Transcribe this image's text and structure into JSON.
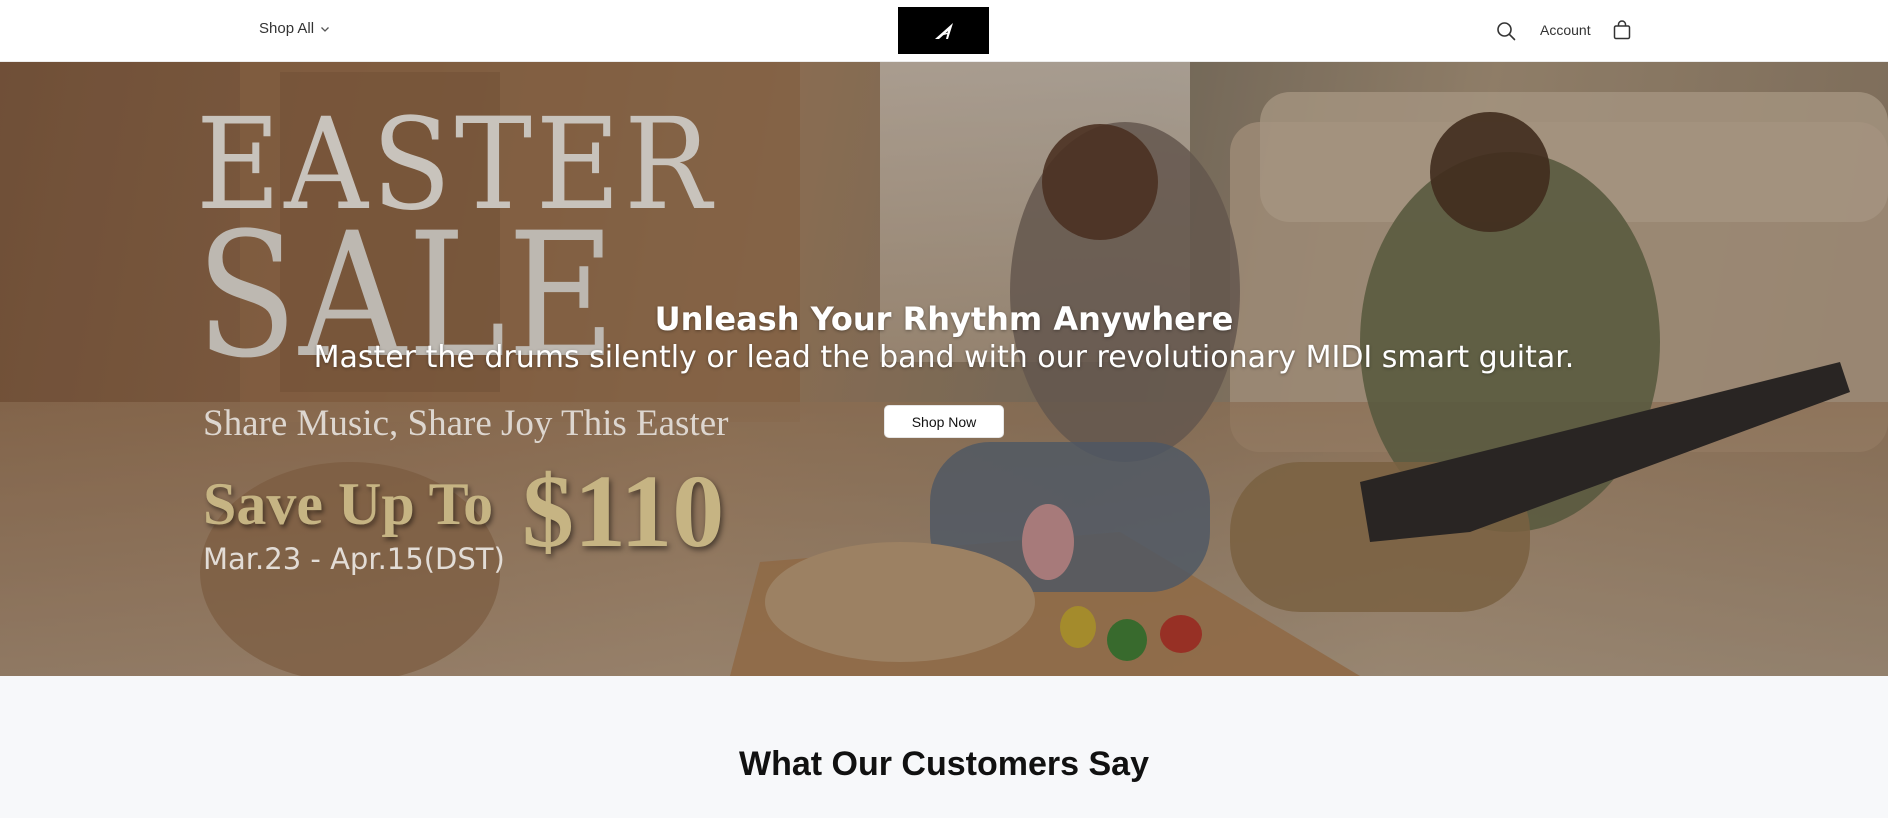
{
  "header": {
    "shop_all_label": "Shop All",
    "account_label": "Account"
  },
  "hero": {
    "banner": {
      "easter": "EASTER",
      "sale": "SALE",
      "tagline": "Share Music, Share Joy This Easter",
      "save_label": "Save Up To",
      "save_amount": "$110",
      "dates": "Mar.23 - Apr.15(DST)"
    },
    "heading": "Unleash Your Rhythm Anywhere",
    "subheading": "Master the drums silently or lead the band with our revolutionary MIDI smart guitar.",
    "cta_label": "Shop Now"
  },
  "testimonials": {
    "title": "What Our Customers Say"
  },
  "colors": {
    "banner_gold": "#c6b483",
    "banner_silver": "#c8c3bc",
    "logo_bg": "#000000",
    "section_bg": "#f7f8fa"
  },
  "icons": [
    "chevron-down-icon",
    "brand-logo-icon",
    "search-icon",
    "shopping-bag-icon"
  ]
}
